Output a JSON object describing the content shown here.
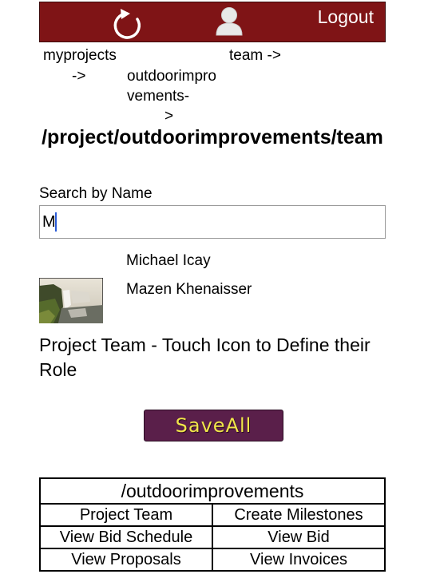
{
  "header": {
    "logout_label": "Logout",
    "bar_color": "#7f1416",
    "icons": [
      "refresh-icon",
      "user-icon"
    ]
  },
  "breadcrumb": {
    "myprojects": "myprojects",
    "arrow_1": "->",
    "outdoorimprovements": "outdoorimprovements-",
    "arrow_3": ">",
    "team": "team ->"
  },
  "page_title": "/project/outdoorimprovements/team",
  "search": {
    "label": "Search by Name",
    "value": "M"
  },
  "results": [
    {
      "name": "Michael Icay"
    },
    {
      "name": "Mazen Khenaisser"
    }
  ],
  "team_heading": "Project Team - Touch Icon to Define their Role",
  "save_button": {
    "label": "SaveAll",
    "bg_color": "#5a1f4a",
    "text_color": "#f0e64a"
  },
  "nav": {
    "title": "/outdoorimprovements",
    "rows": [
      [
        "Project Team",
        "Create Milestones"
      ],
      [
        "View Bid Schedule",
        "View Bid"
      ],
      [
        "View Proposals",
        "View Invoices"
      ]
    ]
  }
}
